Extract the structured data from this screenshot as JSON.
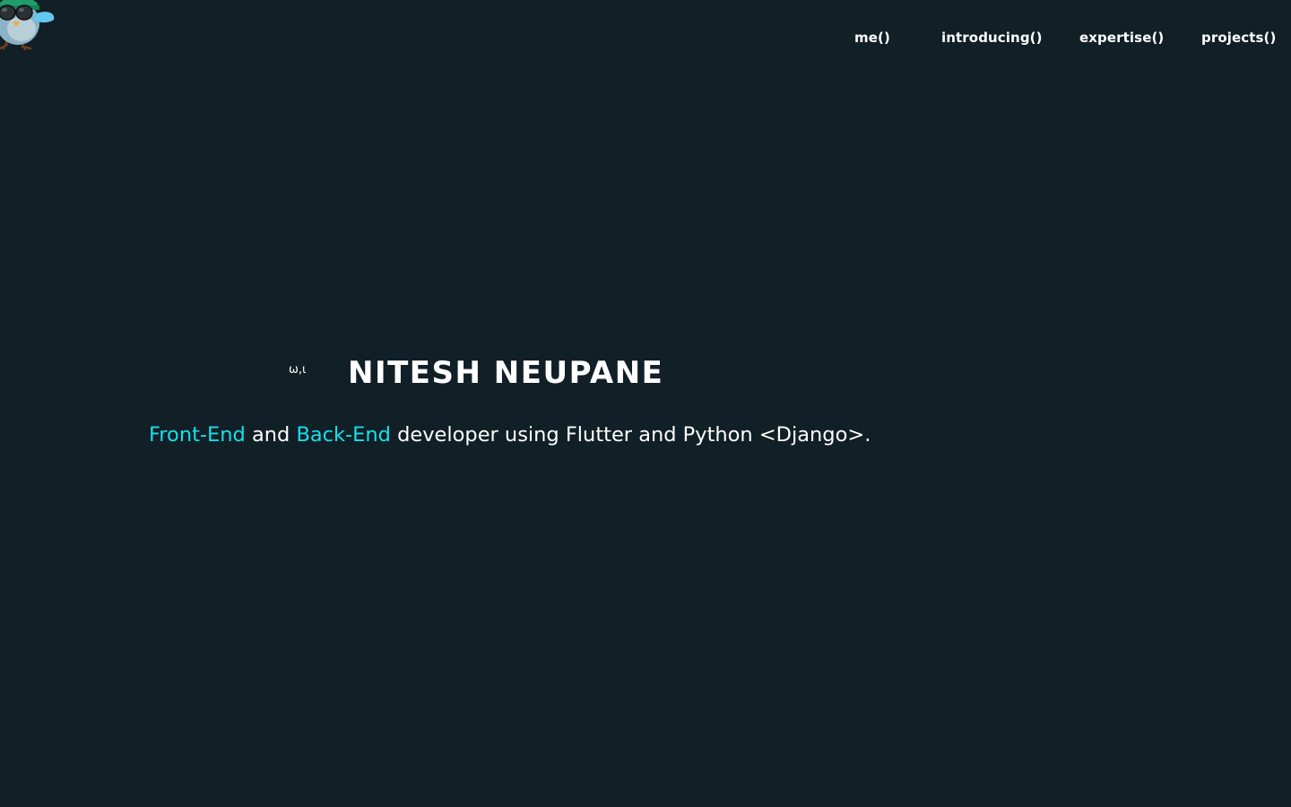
{
  "nav": {
    "items": [
      {
        "label": "me()"
      },
      {
        "label": "introducing()"
      },
      {
        "label": "expertise()"
      },
      {
        "label": "projects()"
      }
    ]
  },
  "hero": {
    "greeting": "ω,ι",
    "name": "NITESH NEUPANE",
    "tagline": {
      "accent_1": "Front-End",
      "text_1": " and ",
      "accent_2": "Back-End",
      "text_2": " developer using Flutter and Python <Django>."
    }
  },
  "colors": {
    "background": "#111f26",
    "accent": "#18e0ea",
    "text": "#ffffff"
  },
  "icons": {
    "logo": "bird-mascot-with-sunglasses-icon"
  }
}
